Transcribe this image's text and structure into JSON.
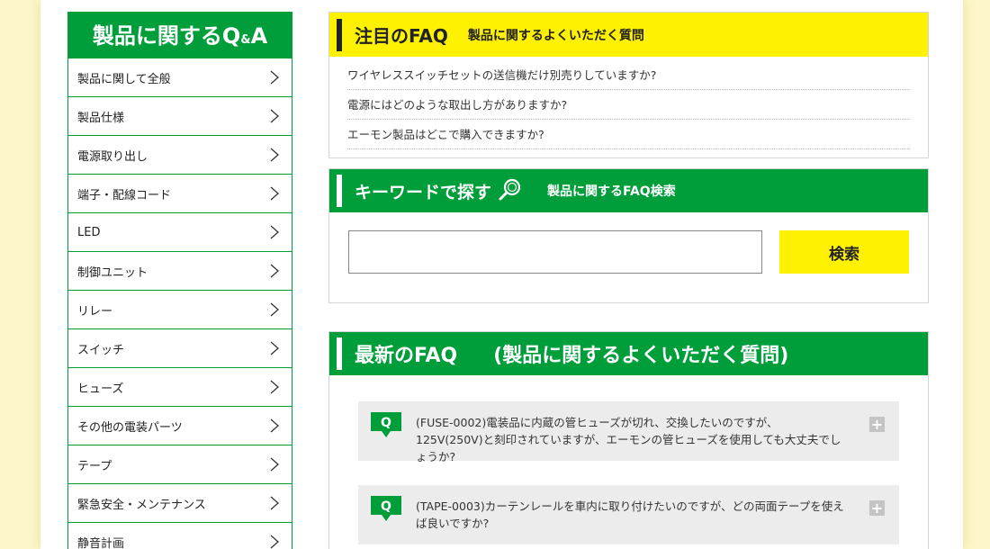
{
  "sidebar": {
    "title_main": "製品に関する",
    "title_q": "Q",
    "title_amp": "&",
    "title_a": "A",
    "items": [
      {
        "label": "製品に関して全般"
      },
      {
        "label": "製品仕様"
      },
      {
        "label": "電源取り出し"
      },
      {
        "label": "端子・配線コード"
      },
      {
        "label": "LED"
      },
      {
        "label": "制御ユニット"
      },
      {
        "label": "リレー"
      },
      {
        "label": "スイッチ"
      },
      {
        "label": "ヒューズ"
      },
      {
        "label": "その他の電装パーツ"
      },
      {
        "label": "テープ"
      },
      {
        "label": "緊急安全・メンテナンス"
      },
      {
        "label": "静音計画"
      }
    ]
  },
  "featured": {
    "title": "注目のFAQ",
    "subtitle": "製品に関するよくいただく質問",
    "links": [
      "ワイヤレススイッチセットの送信機だけ別売りしていますか?",
      "電源にはどのような取出し方がありますか?",
      "エーモン製品はどこで購入できますか?"
    ]
  },
  "search": {
    "title": "キーワードで探す",
    "subtitle": "製品に関するFAQ検索",
    "input_value": "",
    "button_label": "検索"
  },
  "latest": {
    "title": "最新のFAQ",
    "subtitle": "(製品に関するよくいただく質問)",
    "badge": "Q",
    "items": [
      {
        "text": "(FUSE-0002)電装品に内蔵の管ヒューズが切れ、交換したいのですが、125V(250V)と刻印されていますが、エーモンの管ヒューズを使用しても大丈夫でしょうか?",
        "toggle": "+"
      },
      {
        "text": "(TAPE-0003)カーテンレールを車内に取り付けたいのですが、どの両面テープを使えば良いですか?",
        "toggle": "+"
      }
    ]
  },
  "colors": {
    "brand_green": "#009e3b",
    "highlight_yellow": "#fff200",
    "background_cream": "#fdf6c9"
  }
}
